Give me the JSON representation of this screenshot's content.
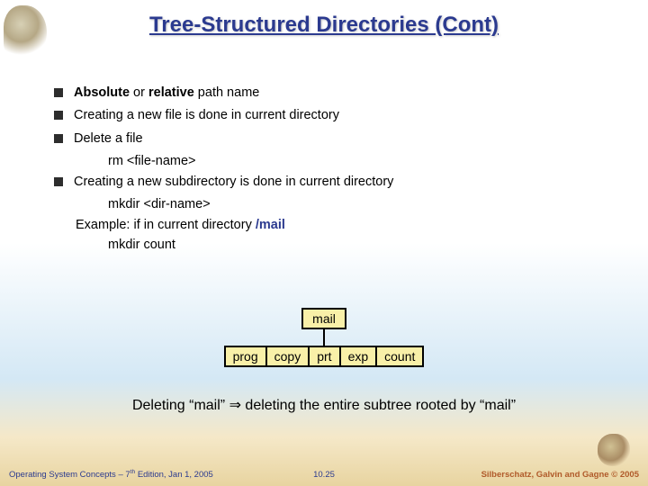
{
  "title": "Tree-Structured Directories (Cont)",
  "bullets": {
    "b1a": "Absolute",
    "b1b": " or ",
    "b1c": "relative",
    "b1d": " path name",
    "b2": "Creating a new file is done in current directory",
    "b3": "Delete a file",
    "b3_cmd": "rm <file-name>",
    "b4": "Creating a new subdirectory is done in current directory",
    "b4_cmd": "mkdir <dir-name>",
    "b4_ex_a": "Example:  if in current directory   ",
    "b4_ex_b": "/mail",
    "b4_cmd2": "mkdir count"
  },
  "tree": {
    "root": "mail",
    "children": [
      "prog",
      "copy",
      "prt",
      "exp",
      "count"
    ]
  },
  "deleting": {
    "a": "Deleting “mail” ",
    "arrow": "⇒",
    "b": " deleting the entire subtree rooted by “mail”"
  },
  "footer": {
    "left_a": "Operating System Concepts – 7",
    "left_sup": "th",
    "left_b": " Edition, Jan 1, 2005",
    "center": "10.25",
    "right_a": "Silberschatz, Galvin and Gagne ",
    "right_b": "©",
    "right_c": " 2005"
  }
}
